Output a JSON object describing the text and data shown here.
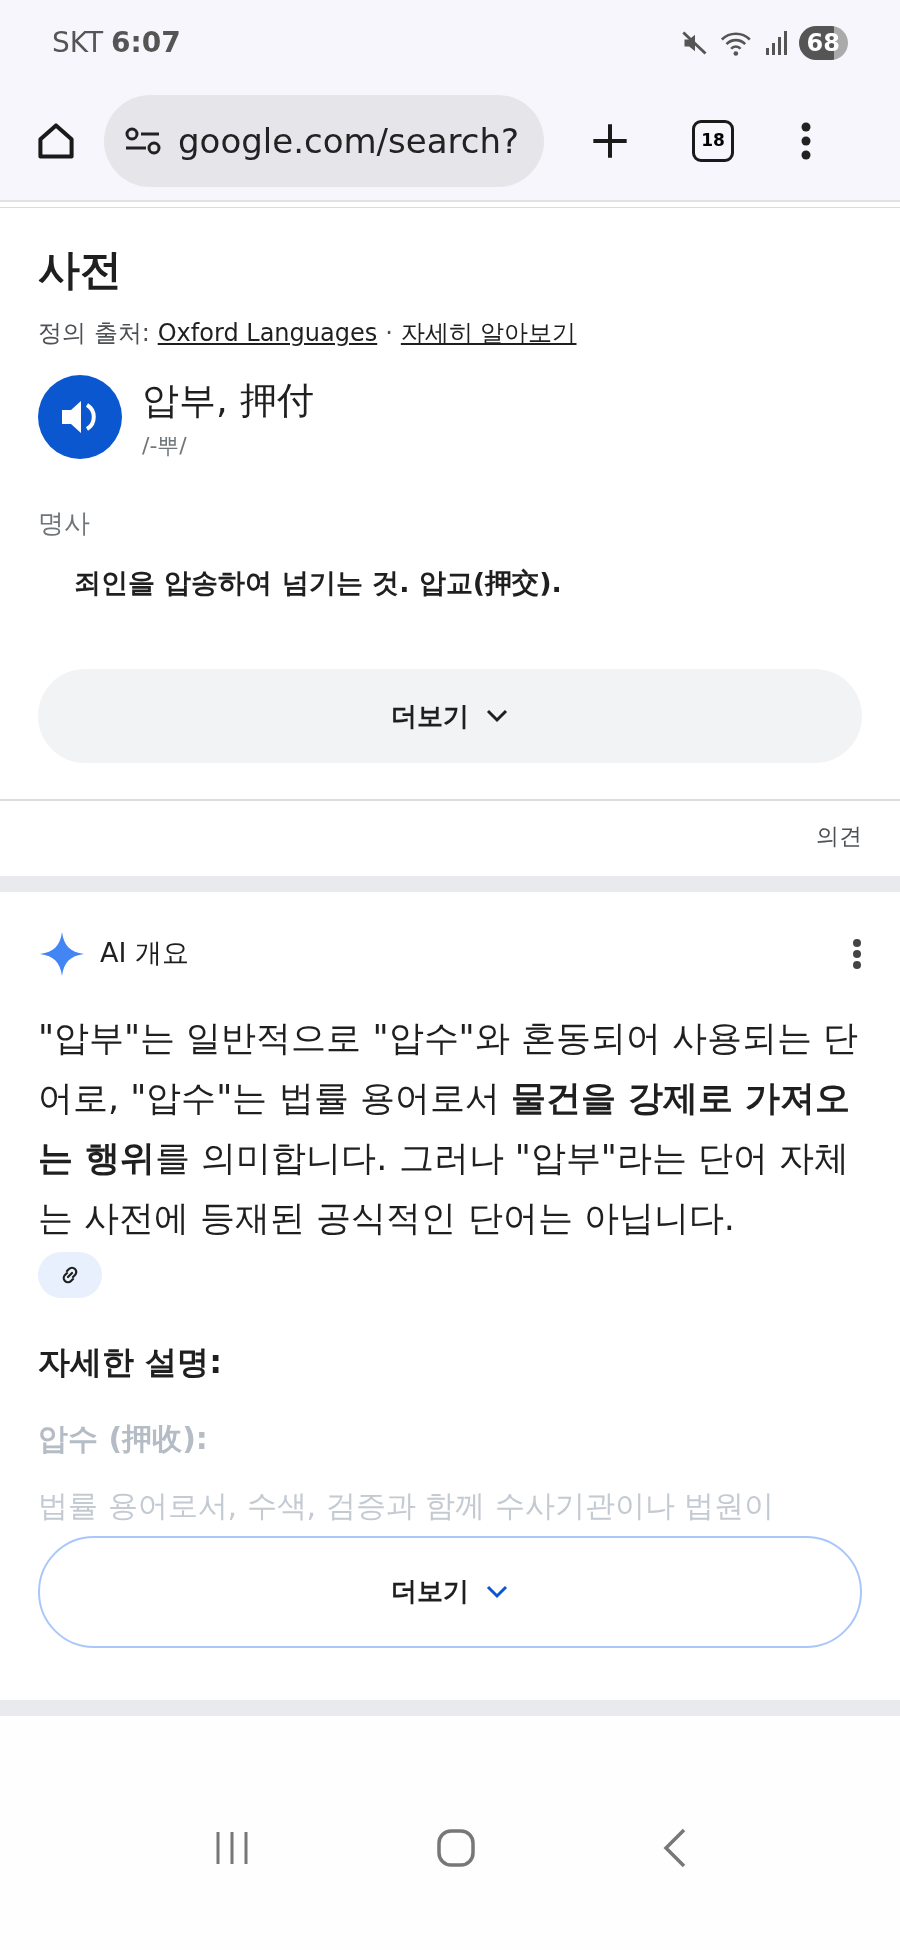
{
  "status_bar": {
    "carrier": "SKT",
    "time": "6:07",
    "battery": "68"
  },
  "browser": {
    "url": "google.com/search?",
    "tab_count": "18"
  },
  "dictionary": {
    "title": "사전",
    "source_label": "정의 출처:",
    "source_link": "Oxford Languages",
    "separator": "·",
    "learn_more": "자세히 알아보기",
    "word": "압부, 押付",
    "pronunciation": "/-뿌/",
    "part_of_speech": "명사",
    "definition": "죄인을 압송하여 넘기는 것. 압교(押交).",
    "more_button": "더보기",
    "feedback": "의견"
  },
  "ai_overview": {
    "title": "AI 개요",
    "summary": "\"압부\"는 일반적으로 \"압수\"와 혼동되어 사용되는 단어로, \"압수\"는 법률 용어로서 **물건을 강제로 가져오는 행위**를 의미합니다. 그러나 \"압부\"라는 단어 자체는 사전에 등재된 공식적인 단어는 아닙니다.",
    "details_heading": "자세한 설명:",
    "term": "압수 (押收):",
    "faded_line": "법률 용어로서, 수색, 검증과 함께 수사기관이나 법원이",
    "more_button": "더보기"
  }
}
